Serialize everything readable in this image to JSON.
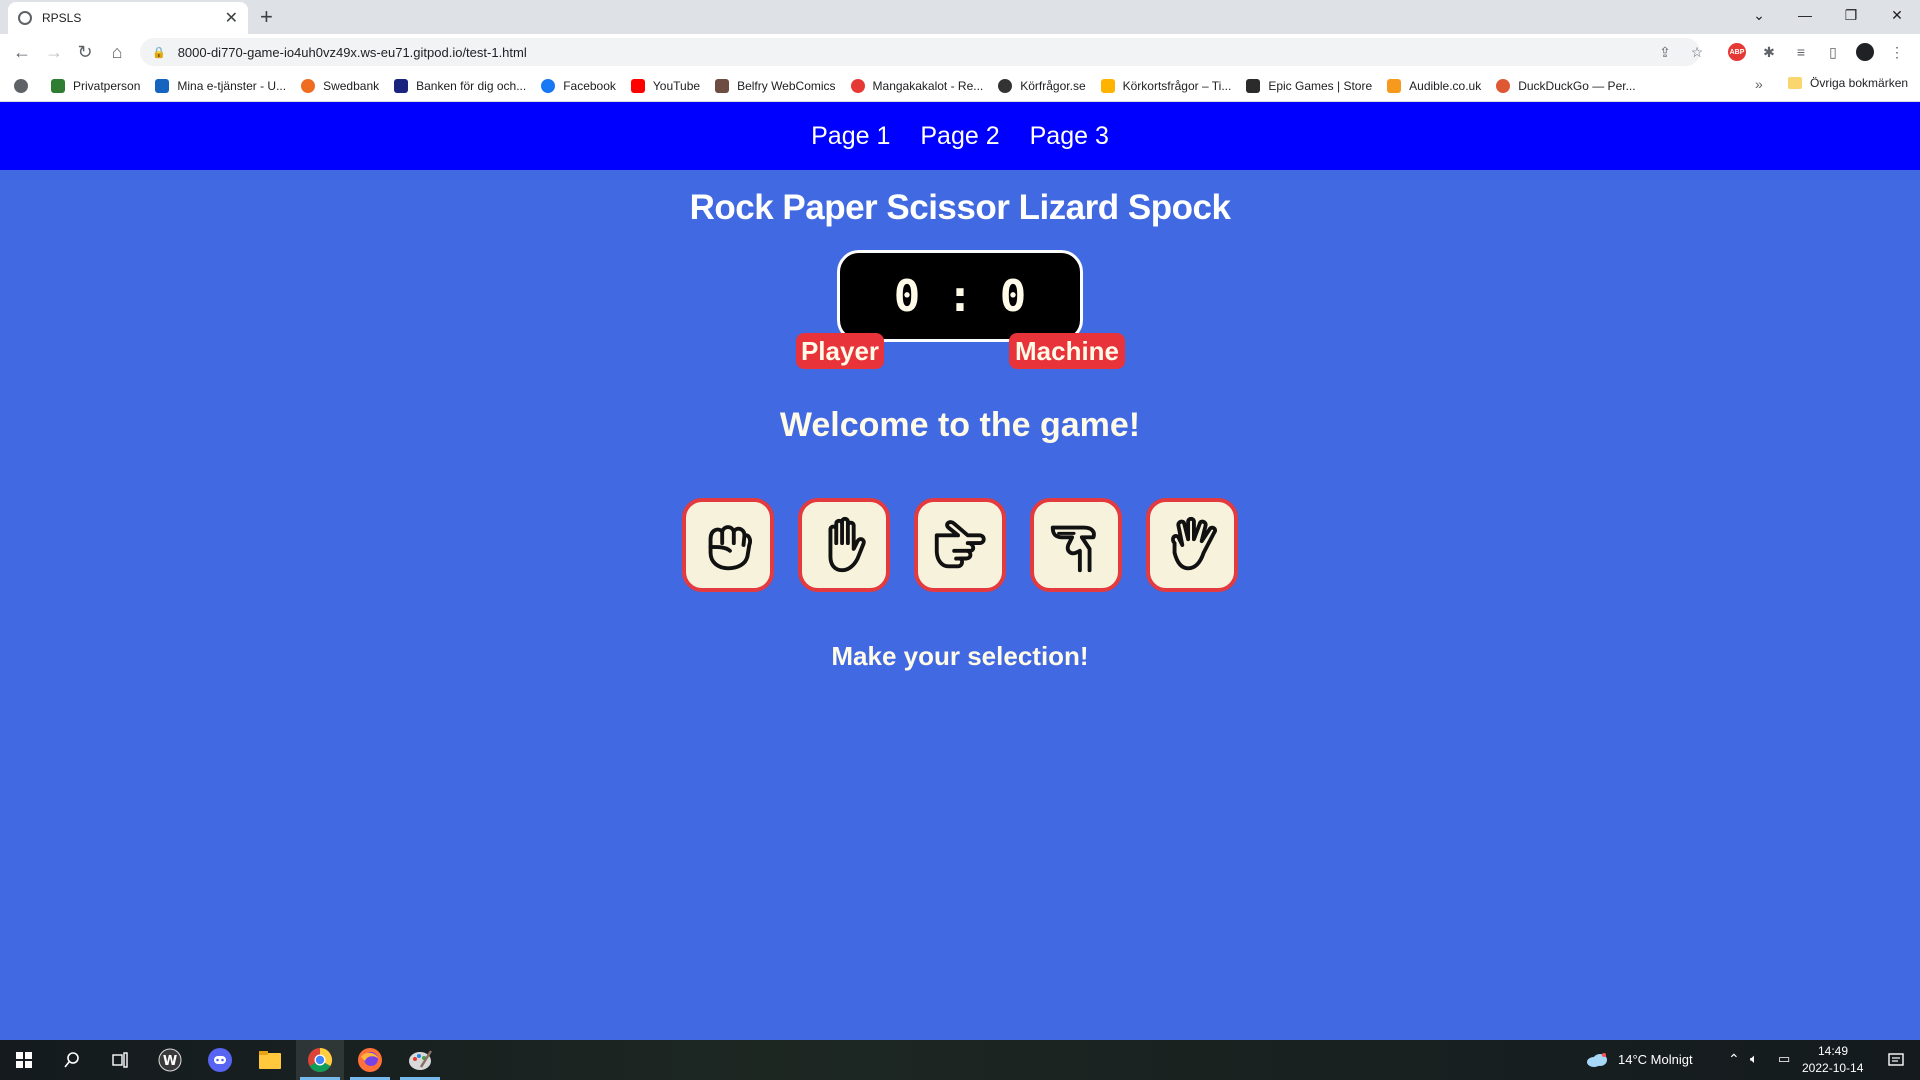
{
  "browser": {
    "tab_title": "RPSLS",
    "url": "8000-di770-game-io4uh0vz49x.ws-eu71.gitpod.io/test-1.html",
    "bookmarks": [
      {
        "label": "Privatperson",
        "color": "#2e7d32"
      },
      {
        "label": "Mina e-tjänster - U...",
        "color": "#1565c0"
      },
      {
        "label": "Swedbank",
        "color": "#ee6c20"
      },
      {
        "label": "Banken för dig och...",
        "color": "#1a237e"
      },
      {
        "label": "Facebook",
        "color": "#1877f2"
      },
      {
        "label": "YouTube",
        "color": "#ff0000"
      },
      {
        "label": "Belfry WebComics",
        "color": "#6d4c41"
      },
      {
        "label": "Mangakakalot - Re...",
        "color": "#e53935"
      },
      {
        "label": "Körfrågor.se",
        "color": "#333333"
      },
      {
        "label": "Körkortsfrågor – Ti...",
        "color": "#ffb300"
      },
      {
        "label": "Epic Games | Store",
        "color": "#2b2b2b"
      },
      {
        "label": "Audible.co.uk",
        "color": "#f7991c"
      },
      {
        "label": "DuckDuckGo — Per...",
        "color": "#de5833"
      }
    ],
    "other_bookmarks": "Övriga bokmärken"
  },
  "nav": {
    "links": [
      "Page 1",
      "Page 2",
      "Page 3"
    ]
  },
  "game": {
    "title": "Rock Paper Scissor Lizard Spock",
    "score_display": "0:0",
    "player_label": "Player",
    "machine_label": "Machine",
    "welcome": "Welcome to the game!",
    "message": "Make your selection!",
    "choices": [
      "rock",
      "paper",
      "scissors",
      "lizard",
      "spock"
    ]
  },
  "taskbar": {
    "weather": "14°C  Molnigt",
    "time": "14:49",
    "date": "2022-10-14"
  },
  "colors": {
    "page_bg": "#4169e1",
    "nav_bg": "#0000ff",
    "accent_red": "#e8333b",
    "cream": "#fffbe8"
  }
}
